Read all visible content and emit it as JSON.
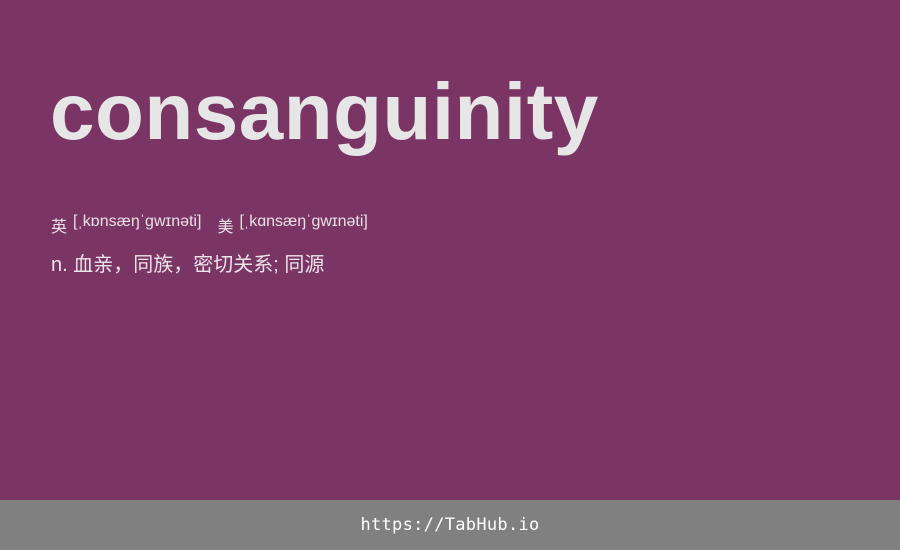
{
  "entry": {
    "word": "consanguinity",
    "phonetics": {
      "uk_label": "英",
      "uk_ipa": "[ˌkɒnsæŋˈɡwɪnəti]",
      "us_label": "美",
      "us_ipa": "[ˌkɑnsæŋˈɡwɪnəti]"
    },
    "definition": "n. 血亲，同族，密切关系; 同源"
  },
  "footer": {
    "link_text": "https://TabHub.io"
  },
  "colors": {
    "background": "#7b3565",
    "footer_background": "#808080",
    "word_text": "#e6e6e6"
  }
}
